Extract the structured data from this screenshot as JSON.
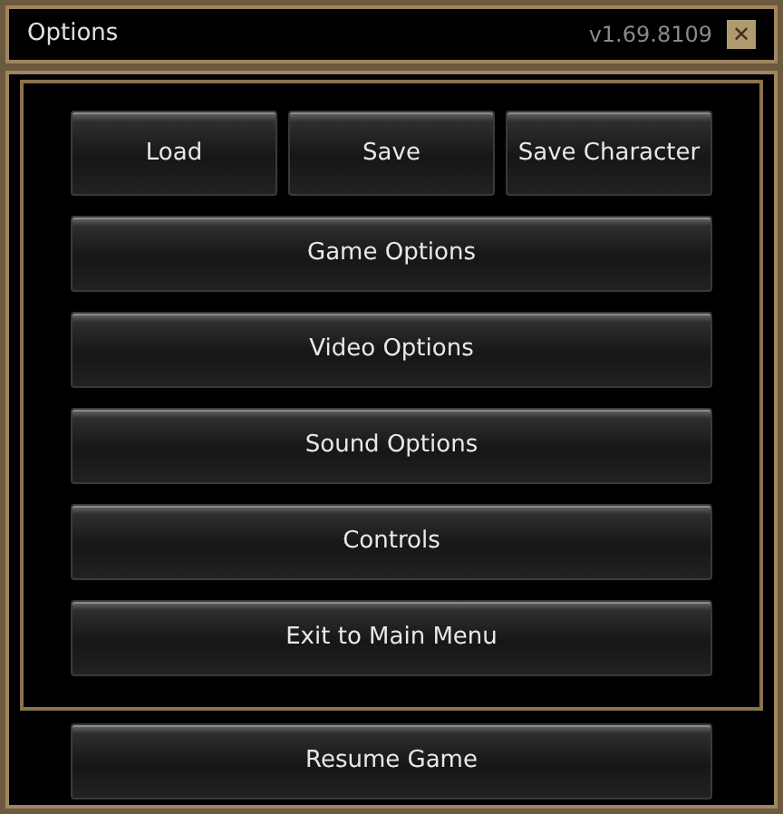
{
  "window": {
    "title": "Options",
    "version": "v1.69.8109",
    "close": "✕"
  },
  "top_buttons": [
    "Load",
    "Save",
    "Save Character"
  ],
  "menu_buttons": [
    "Game Options",
    "Video Options",
    "Sound Options",
    "Controls",
    "Exit to Main Menu"
  ],
  "resume_button": "Resume Game"
}
